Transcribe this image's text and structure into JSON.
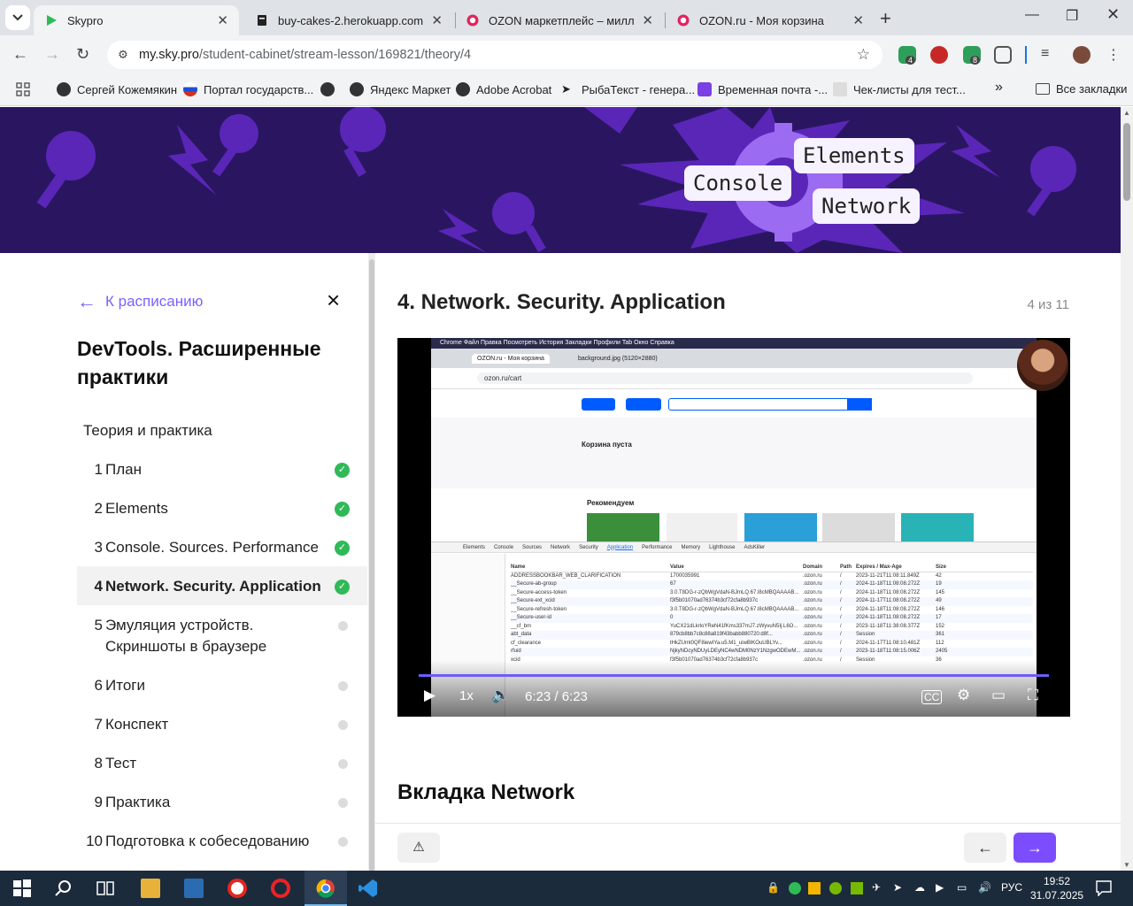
{
  "browser": {
    "tabs": [
      {
        "title": "Skypro",
        "active": true
      },
      {
        "title": "buy-cakes-2.herokuapp.com",
        "active": false
      },
      {
        "title": "OZON маркетплейс – миллио",
        "active": false
      },
      {
        "title": "OZON.ru - Моя корзина",
        "active": false
      }
    ],
    "address": {
      "host": "my.sky.pro",
      "path": "/student-cabinet/stream-lesson/169821/theory/4"
    },
    "extension_badges": [
      "4",
      "8"
    ],
    "bookmarks": [
      "Сергей Кожемякин",
      "Портал государств...",
      "Яндекс Маркет",
      "Adobe Acrobat",
      "РыбаТекст - генера...",
      "Временная почта -...",
      "Чек-листы для тест...",
      "Все закладки"
    ],
    "overflow": "»"
  },
  "banner": {
    "tags": [
      "Elements",
      "Console",
      "Network"
    ]
  },
  "sidebar": {
    "back_label": "К расписанию",
    "close_icon": "×",
    "course_title": "DevTools. Расширенные практики",
    "section_title": "Теория и практика",
    "items": [
      {
        "num": "1",
        "label": "План",
        "done": true
      },
      {
        "num": "2",
        "label": "Elements",
        "done": true
      },
      {
        "num": "3",
        "label": "Console. Sources. Performance",
        "done": true
      },
      {
        "num": "4",
        "label": "Network. Security. Application",
        "done": true,
        "active": true
      },
      {
        "num": "5",
        "label": "Эмуляция устройств. Скриншоты в браузере",
        "done": false
      },
      {
        "num": "6",
        "label": "Итоги",
        "done": false
      },
      {
        "num": "7",
        "label": "Конспект",
        "done": false
      },
      {
        "num": "8",
        "label": "Тест",
        "done": false
      },
      {
        "num": "9",
        "label": "Практика",
        "done": false
      },
      {
        "num": "10",
        "label": "Подготовка к собеседованию",
        "done": false
      }
    ]
  },
  "content": {
    "lesson_title": "4. Network. Security. Application",
    "counter": "4 из 11",
    "video": {
      "time": "6:23 / 6:23",
      "speed": "1x",
      "progress": 1.0,
      "browser_tabs": [
        "OZON.ru - Моя корзина",
        "background.jpg (5120×2880)"
      ],
      "url": "ozon.ru/cart",
      "cart_empty_title": "Корзина пуста",
      "recommend_title": "Рекомендуем",
      "devtools_tabs": [
        "Elements",
        "Console",
        "Sources",
        "Network",
        "Security",
        "Application",
        "Performance",
        "Memory",
        "Lighthouse",
        "AdsKiller"
      ],
      "cookie_columns": [
        "Name",
        "Value",
        "Domain",
        "Path",
        "Expires / Max-Age",
        "Size"
      ],
      "cookies": [
        [
          "ADDRESSBOOKBAR_WEB_CLARIFICATION",
          "1700035991",
          ".ozon.ru",
          "/",
          "2023-11-21T11:08:11.849Z",
          "42"
        ],
        [
          "__Secure-ab-group",
          "67",
          ".ozon.ru",
          "/",
          "2024-11-18T11:08:08.272Z",
          "19"
        ],
        [
          "__Secure-access-token",
          "3.0.T8DG-r-zQbWgVdaN-BJmLQ.67.l8cMBQAAAAB...",
          ".ozon.ru",
          "/",
          "2024-11-18T11:08:08.272Z",
          "145"
        ],
        [
          "__Secure-ext_xcid",
          "f3f5b01070ad76374b3cf72cfa8b937c",
          ".ozon.ru",
          "/",
          "2024-11-17T11:08:08.272Z",
          "49"
        ],
        [
          "__Secure-refresh-token",
          "3.0.T8DG-r-zQbWgVdaN-BJmLQ.67.l8cMBQAAAAB...",
          ".ozon.ru",
          "/",
          "2024-11-18T11:08:08.272Z",
          "146"
        ],
        [
          "__Secure-user-id",
          "0",
          ".ozon.ru",
          "/",
          "2024-11-18T11:08:08.272Z",
          "17"
        ],
        [
          "__cf_bm",
          "YuCX21dLkrloYReN41fKms337mJ7.zWyvuN5Ij.L6O...",
          ".ozon.ru",
          "/",
          "2023-11-18T11:38:08.377Z",
          "152"
        ],
        [
          "abt_data",
          "879cb8bb7c8c88a819f43babb880720:d8f...",
          ".ozon.ru",
          "/",
          "Session",
          "361"
        ],
        [
          "cf_clearance",
          "tHkZUmt0QF8iewIYa.u5.M1_uiwBlKOuUBLYv...",
          ".ozon.ru",
          "/",
          "2024-11-17T11:08:10.481Z",
          "112"
        ],
        [
          "rfuid",
          "NjkyNDcyNDUyLDEyNC4wNDM0NzY1NzgwODEwM...",
          ".ozon.ru",
          "/",
          "2023-11-18T11:08:15.006Z",
          "2405"
        ],
        [
          "xcid",
          "f3f5b01070ad76374b3cf72cfa8b937c",
          ".ozon.ru",
          "/",
          "Session",
          "36"
        ]
      ]
    },
    "section_heading": "Вкладка Network"
  },
  "taskbar": {
    "lang": "РУС",
    "time": "19:52",
    "date": "31.07.2025"
  }
}
